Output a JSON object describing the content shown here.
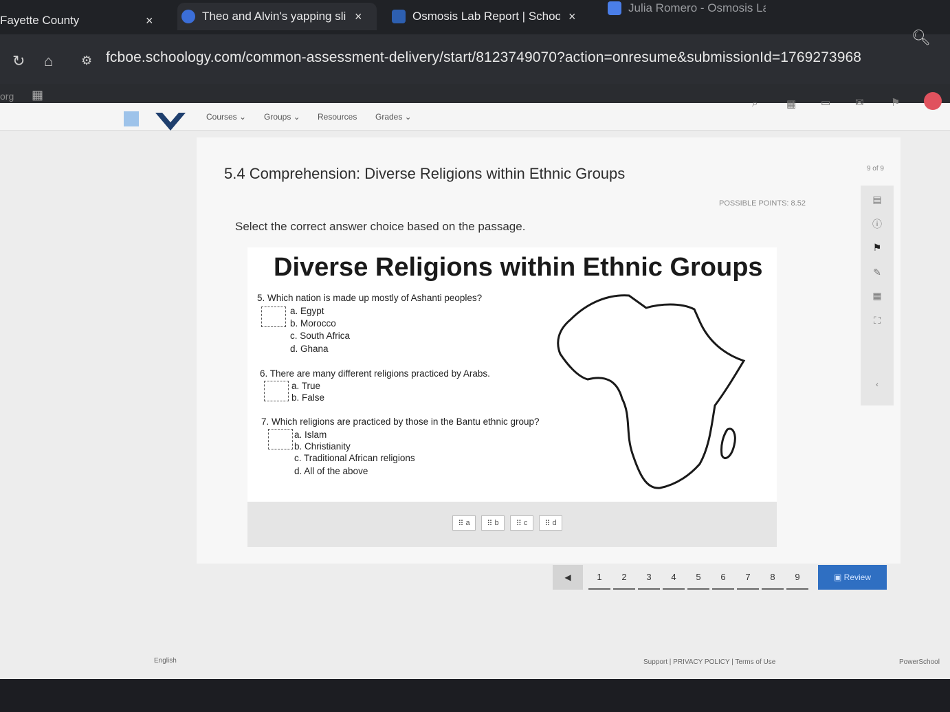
{
  "browser": {
    "tabs": [
      {
        "title": "Fayette County",
        "close": "×"
      },
      {
        "title": "Theo and Alvin's yapping sli",
        "close": "×"
      },
      {
        "title": "Osmosis Lab Report | Schoo",
        "close": "×"
      },
      {
        "title": "Julia Romero - Osmosis Lab",
        "close": ""
      }
    ],
    "url": "fcboe.schoology.com/common-assessment-delivery/start/8123749070?action=onresume&submissionId=1769273968",
    "bookmark_label": "org"
  },
  "site_nav": {
    "items": [
      "Courses ⌄",
      "Groups ⌄",
      "Resources",
      "Grades ⌄"
    ]
  },
  "assessment": {
    "title": "5.4 Comprehension: Diverse Religions within Ethnic Groups",
    "counter": "9 of 9",
    "possible_points": "POSSIBLE POINTS: 8.52",
    "instruction": "Select the correct answer choice based on the passage."
  },
  "passage": {
    "title": "Diverse Religions within Ethnic Groups",
    "questions": [
      {
        "text": "5. Which nation is made up mostly of Ashanti peoples?",
        "options": [
          "a. Egypt",
          "b. Morocco",
          "c. South Africa",
          "d. Ghana"
        ]
      },
      {
        "text": "6. There are many different religions practiced by Arabs.",
        "options": [
          "a. True",
          "b. False"
        ]
      },
      {
        "text": "7. Which religions are practiced by those in the Bantu ethnic group?",
        "options": [
          "a.   Islam",
          "b.   Christianity",
          "c.   Traditional African religions",
          "d.   All of the above"
        ]
      }
    ]
  },
  "drag_choices": [
    "a",
    "b",
    "c",
    "d"
  ],
  "pager": {
    "prev": "◀",
    "pages": [
      "1",
      "2",
      "3",
      "4",
      "5",
      "6",
      "7",
      "8",
      "9"
    ],
    "review": "Review"
  },
  "footer": {
    "language": "English",
    "links": "Support  |  PRIVACY POLICY  |  Terms of Use",
    "brand": "PowerSchool"
  }
}
